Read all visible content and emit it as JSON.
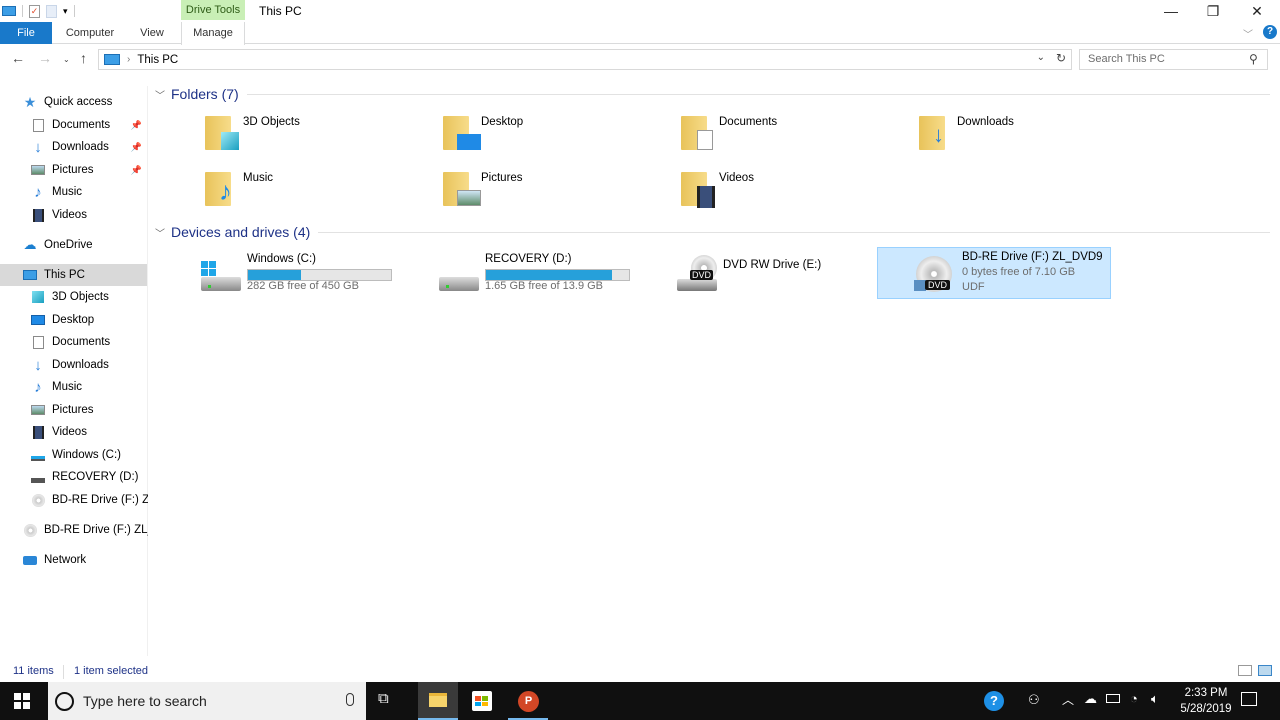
{
  "window": {
    "title": "This PC",
    "context_tab": "Drive Tools",
    "controls": {
      "minimize": "—",
      "restore": "❐",
      "close": "✕"
    }
  },
  "ribbon": {
    "tabs": [
      {
        "label": "File",
        "active": false
      },
      {
        "label": "Computer"
      },
      {
        "label": "View"
      },
      {
        "label": "Manage",
        "active": true
      }
    ]
  },
  "address": {
    "path": "This PC",
    "search_placeholder": "Search This PC"
  },
  "sidebar": {
    "quick_access": "Quick access",
    "quick_items": [
      {
        "label": "Documents",
        "pinned": true
      },
      {
        "label": "Downloads",
        "pinned": true
      },
      {
        "label": "Pictures",
        "pinned": true
      },
      {
        "label": "Music"
      },
      {
        "label": "Videos"
      }
    ],
    "onedrive": "OneDrive",
    "this_pc": "This PC",
    "pc_items": [
      {
        "label": "3D Objects"
      },
      {
        "label": "Desktop"
      },
      {
        "label": "Documents"
      },
      {
        "label": "Downloads"
      },
      {
        "label": "Music"
      },
      {
        "label": "Pictures"
      },
      {
        "label": "Videos"
      },
      {
        "label": "Windows (C:)"
      },
      {
        "label": "RECOVERY (D:)"
      },
      {
        "label": "BD-RE Drive (F:) ZL_"
      }
    ],
    "bd_drive": "BD-RE Drive (F:) ZL_D",
    "network": "Network"
  },
  "content": {
    "folders_header": "Folders (7)",
    "folders": [
      {
        "label": "3D Objects",
        "icon": "3d-objects-icon"
      },
      {
        "label": "Desktop",
        "icon": "desktop-icon"
      },
      {
        "label": "Documents",
        "icon": "documents-icon"
      },
      {
        "label": "Downloads",
        "icon": "downloads-icon"
      },
      {
        "label": "Music",
        "icon": "music-icon"
      },
      {
        "label": "Pictures",
        "icon": "pictures-icon"
      },
      {
        "label": "Videos",
        "icon": "videos-icon"
      }
    ],
    "drives_header": "Devices and drives (4)",
    "drives": [
      {
        "name": "Windows (C:)",
        "free": "282 GB free of 450 GB",
        "used_fraction": 0.373
      },
      {
        "name": "RECOVERY (D:)",
        "free": "1.65 GB free of 13.9 GB",
        "used_fraction": 0.881
      },
      {
        "name": "DVD RW Drive (E:)"
      },
      {
        "name": "BD-RE Drive (F:) ZL_DVD9",
        "free": "0 bytes free of 7.10 GB",
        "fs": "UDF",
        "selected": true
      }
    ],
    "dvd_badge": "DVD"
  },
  "status": {
    "items": "11 items",
    "selected": "1 item selected"
  },
  "taskbar": {
    "search_placeholder": "Type here to search",
    "time": "2:33 PM",
    "date": "5/28/2019"
  },
  "colors": {
    "accent": "#1979ca",
    "drive_bar": "#26a0da",
    "selection": "#cce8ff",
    "header_text": "#1e3287"
  }
}
